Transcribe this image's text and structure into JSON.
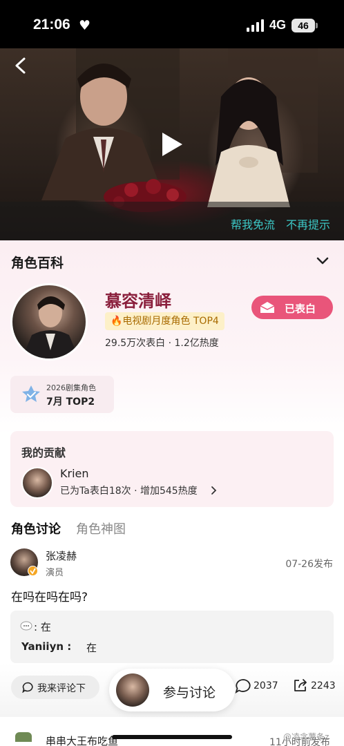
{
  "status_bar": {
    "time": "21:06",
    "network": "4G",
    "battery": "46"
  },
  "video": {
    "free_flow_label": "帮我免流",
    "no_remind_label": "不再提示"
  },
  "encyclopedia": {
    "title": "角色百科",
    "character_name": "慕容清峄",
    "rank_badge": "🔥电视剧月度角色 TOP4",
    "stats": "29.5万次表白 · 1.2亿热度",
    "confessed_label": "已表白",
    "year_badge": {
      "label": "2026剧集角色",
      "rank": "7月 TOP2"
    }
  },
  "contribution": {
    "title": "我的贡献",
    "user": "Krien",
    "detail": "已为Ta表白18次 · 增加545热度"
  },
  "tabs": {
    "discuss": "角色讨论",
    "gallery": "角色神图"
  },
  "post": {
    "author": "张凌赫",
    "role": "演员",
    "time": "07-26发布",
    "text": "在吗在吗在吗?",
    "reply1": ": 在",
    "reply2_name": "Yaniiyn :",
    "reply2_text": "在"
  },
  "bottom_bar": {
    "comment_label": "我来评论下",
    "join_label": "参与讨论",
    "reply_count": "2037",
    "share_count": "2243"
  },
  "next_post": {
    "author": "串串大王布吃鱼",
    "time": "11小时前发布"
  },
  "watermark": "@凌衾薯条z",
  "colors": {
    "accent_pink": "#e9557a",
    "name_color": "#8a1f3c",
    "link_teal": "#3cc9c7",
    "badge_gold": "#a86a00"
  }
}
